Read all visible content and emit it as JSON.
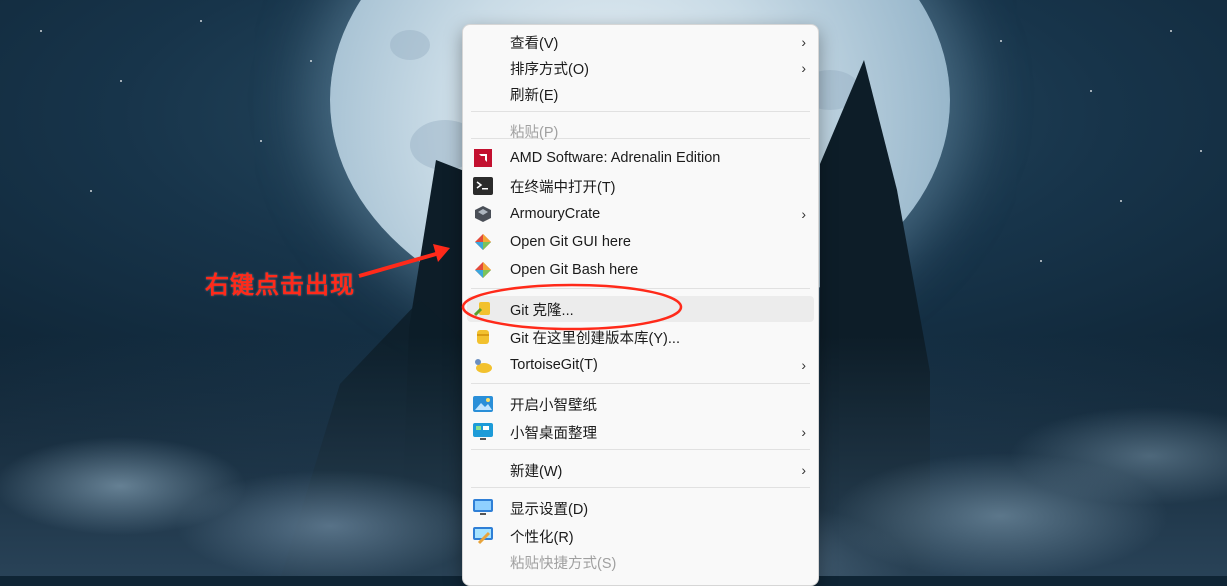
{
  "menu": {
    "items": [
      {
        "label": "查看(V)",
        "icon": "",
        "submenu": true,
        "disabled": false
      },
      {
        "label": "排序方式(O)",
        "icon": "",
        "submenu": true,
        "disabled": false
      },
      {
        "label": "刷新(E)",
        "icon": "",
        "submenu": false,
        "disabled": false
      },
      {
        "label": "粘贴(P)",
        "icon": "",
        "submenu": false,
        "disabled": true
      },
      {
        "label": "AMD Software: Adrenalin Edition",
        "icon": "amd-icon",
        "submenu": false,
        "disabled": false
      },
      {
        "label": "在终端中打开(T)",
        "icon": "terminal-icon",
        "submenu": false,
        "disabled": false
      },
      {
        "label": "ArmouryCrate",
        "icon": "armoury-crate-icon",
        "submenu": true,
        "disabled": false
      },
      {
        "label": "Open Git GUI here",
        "icon": "git-gui-icon",
        "submenu": false,
        "disabled": false
      },
      {
        "label": "Open Git Bash here",
        "icon": "git-bash-icon",
        "submenu": false,
        "disabled": false
      },
      {
        "label": "Git 克隆...",
        "icon": "tortoisegit-clone-icon",
        "submenu": false,
        "disabled": false
      },
      {
        "label": "Git 在这里创建版本库(Y)...",
        "icon": "tortoisegit-create-repo-icon",
        "submenu": false,
        "disabled": false
      },
      {
        "label": "TortoiseGit(T)",
        "icon": "tortoisegit-icon",
        "submenu": true,
        "disabled": false
      },
      {
        "label": "开启小智壁纸",
        "icon": "wallpaper-icon",
        "submenu": false,
        "disabled": false
      },
      {
        "label": "小智桌面整理",
        "icon": "desktop-organize-icon",
        "submenu": true,
        "disabled": false
      },
      {
        "label": "新建(W)",
        "icon": "",
        "submenu": true,
        "disabled": false
      },
      {
        "label": "显示设置(D)",
        "icon": "display-settings-icon",
        "submenu": false,
        "disabled": false
      },
      {
        "label": "个性化(R)",
        "icon": "personalize-icon",
        "submenu": false,
        "disabled": false
      },
      {
        "label": "粘贴快捷方式(S)",
        "icon": "",
        "submenu": false,
        "disabled": true
      }
    ],
    "chevron": "›"
  },
  "annotation": {
    "text": "右键点击出现",
    "color": "#ff2a1a"
  }
}
